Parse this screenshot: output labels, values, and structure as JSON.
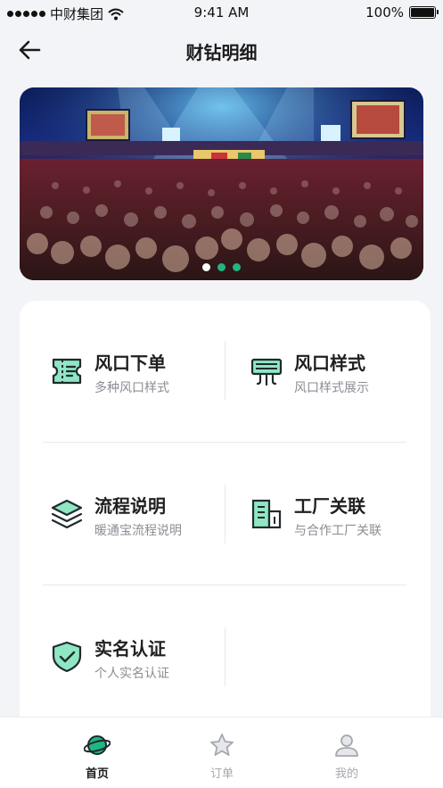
{
  "status_bar": {
    "carrier": "中财集团",
    "time": "9:41 AM",
    "battery": "100%"
  },
  "nav": {
    "title": "财钻明细",
    "back_icon": "arrow-left-icon"
  },
  "banner": {
    "image": "concert-crowd-photo",
    "slide_count": 3,
    "active_slide": 2
  },
  "menu": {
    "items": [
      {
        "title": "风口下单",
        "subtitle": "多种风口样式",
        "icon": "ticket-icon"
      },
      {
        "title": "风口样式",
        "subtitle": "风口样式展示",
        "icon": "air-vent-icon"
      },
      {
        "title": "流程说明",
        "subtitle": "暖通宝流程说明",
        "icon": "layers-icon"
      },
      {
        "title": "工厂关联",
        "subtitle": "与合作工厂关联",
        "icon": "building-icon"
      },
      {
        "title": "实名认证",
        "subtitle": "个人实名认证",
        "icon": "shield-check-icon"
      }
    ]
  },
  "tabbar": {
    "tabs": [
      {
        "label": "首页",
        "icon": "planet-icon",
        "active": true
      },
      {
        "label": "订单",
        "icon": "star-icon",
        "active": false
      },
      {
        "label": "我的",
        "icon": "user-icon",
        "active": false
      }
    ]
  },
  "colors": {
    "accent": "#21b582",
    "accent_light": "#8fe6c3",
    "icon_stroke": "#1f2a2e",
    "background": "#f3f4f7"
  }
}
